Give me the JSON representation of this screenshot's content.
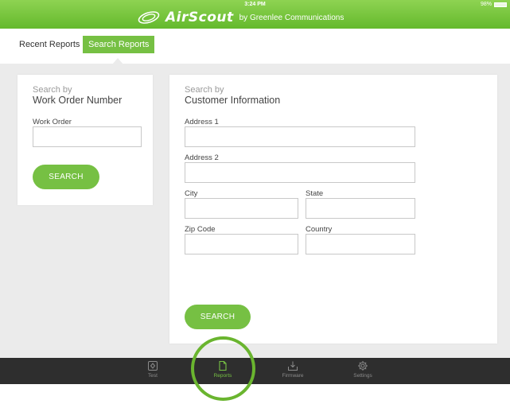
{
  "status_bar": {
    "time": "3:24 PM",
    "battery": "98%"
  },
  "header": {
    "brand_name": "AirScout",
    "brand_sub": "by Greenlee Communications"
  },
  "tabs": [
    {
      "label": "Recent Reports",
      "active": false
    },
    {
      "label": "Search Reports",
      "active": true
    }
  ],
  "work_order_card": {
    "title_small": "Search by",
    "title_big": "Work Order Number",
    "field": {
      "label": "Work Order",
      "value": ""
    },
    "search_button": "SEARCH"
  },
  "customer_card": {
    "title_small": "Search by",
    "title_big": "Customer Information",
    "fields": {
      "address1": {
        "label": "Address 1",
        "value": ""
      },
      "address2": {
        "label": "Address 2",
        "value": ""
      },
      "city": {
        "label": "City",
        "value": ""
      },
      "state": {
        "label": "State",
        "value": ""
      },
      "zip": {
        "label": "Zip Code",
        "value": ""
      },
      "country": {
        "label": "Country",
        "value": ""
      }
    },
    "search_button": "SEARCH"
  },
  "tabbar": [
    {
      "label": "Test",
      "icon": "test-icon",
      "active": false
    },
    {
      "label": "Reports",
      "icon": "reports-icon",
      "active": true
    },
    {
      "label": "Firmware",
      "icon": "firmware-icon",
      "active": false
    },
    {
      "label": "Settings",
      "icon": "settings-icon",
      "active": false
    }
  ],
  "colors": {
    "accent": "#76c043",
    "header": "#6abb35",
    "tabbar": "#2e2e2e",
    "background": "#ebebeb",
    "ring": "#6ab52f"
  }
}
